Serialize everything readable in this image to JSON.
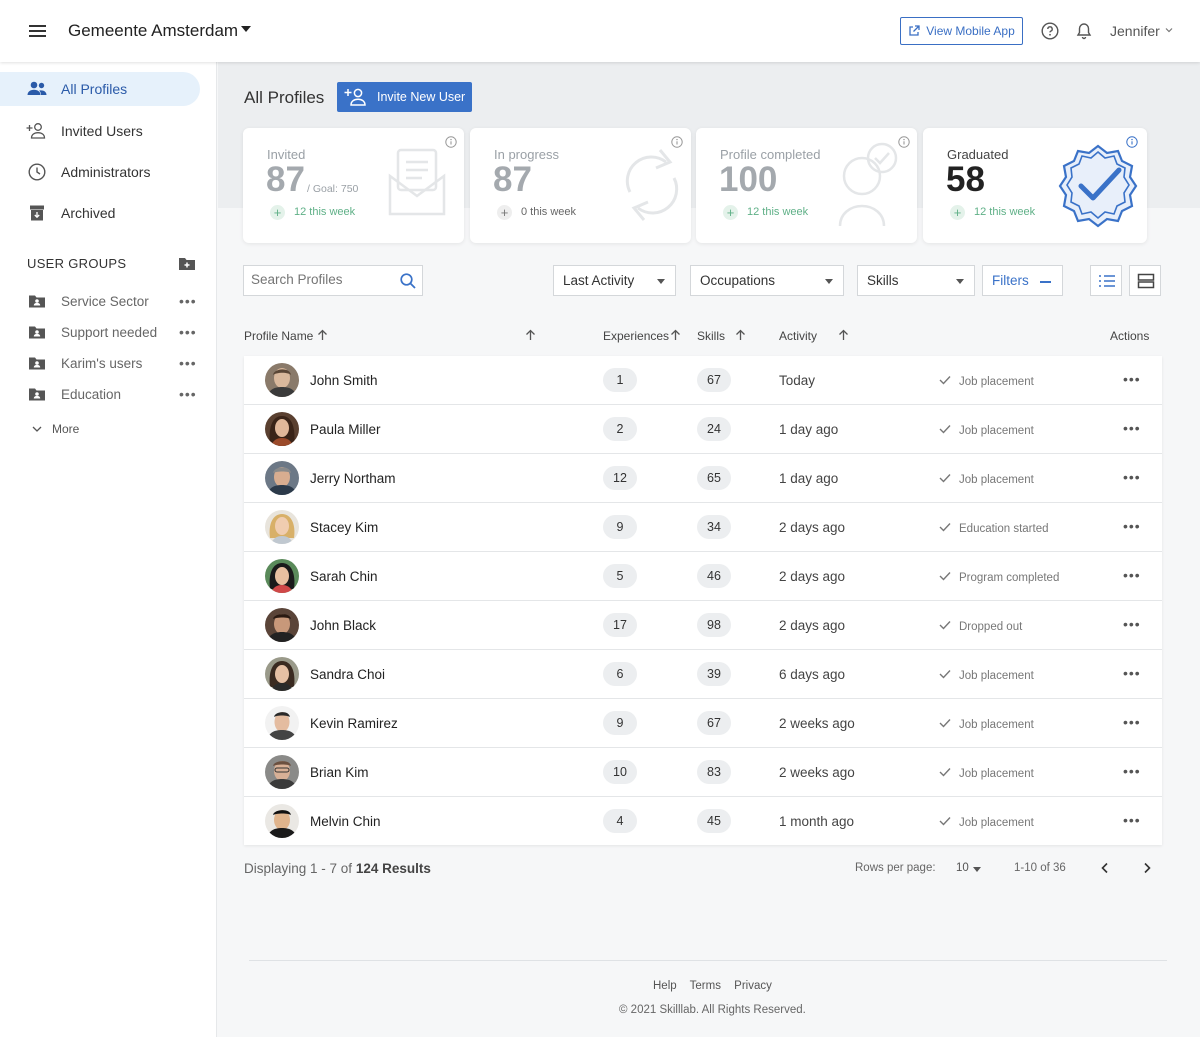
{
  "header": {
    "org_name": "Gemeente Amsterdam",
    "mobile_app_label": "View Mobile App",
    "user_name": "Jennifer"
  },
  "sidebar": {
    "items": [
      {
        "label": "All Profiles",
        "icon": "users-icon",
        "active": true
      },
      {
        "label": "Invited Users",
        "icon": "add-user-icon",
        "active": false
      },
      {
        "label": "Administrators",
        "icon": "clock-icon",
        "active": false
      },
      {
        "label": "Archived",
        "icon": "archive-icon",
        "active": false
      }
    ],
    "groups_title": "USER GROUPS",
    "groups": [
      {
        "label": "Service Sector"
      },
      {
        "label": "Support needed"
      },
      {
        "label": "Karim's users"
      },
      {
        "label": "Education"
      }
    ],
    "more_label": "More"
  },
  "main": {
    "page_title": "All Profiles",
    "invite_label": "Invite New User"
  },
  "stats": [
    {
      "label": "Invited",
      "value": "87",
      "goal": "/ Goal: 750",
      "week": "12 this week"
    },
    {
      "label": "In progress",
      "value": "87",
      "goal": "",
      "week": "0 this week"
    },
    {
      "label": "Profile completed",
      "value": "100",
      "goal": "",
      "week": "12 this week"
    },
    {
      "label": "Graduated",
      "value": "58",
      "goal": "",
      "week": "12 this week"
    }
  ],
  "filters": {
    "search_placeholder": "Search Profiles",
    "last_activity": "Last Activity",
    "occupations": "Occupations",
    "skills": "Skills",
    "filters": "Filters"
  },
  "table": {
    "headers": {
      "name": "Profile Name",
      "experiences": "Experiences",
      "skills": "Skills",
      "activity": "Activity",
      "actions": "Actions"
    },
    "rows": [
      {
        "name": "John Smith",
        "experiences": "1",
        "skills": "67",
        "activity": "Today",
        "status": "Job placement"
      },
      {
        "name": "Paula Miller",
        "experiences": "2",
        "skills": "24",
        "activity": "1 day ago",
        "status": "Job placement"
      },
      {
        "name": "Jerry Northam",
        "experiences": "12",
        "skills": "65",
        "activity": "1 day ago",
        "status": "Job placement"
      },
      {
        "name": "Stacey Kim",
        "experiences": "9",
        "skills": "34",
        "activity": "2 days ago",
        "status": "Education started"
      },
      {
        "name": "Sarah Chin",
        "experiences": "5",
        "skills": "46",
        "activity": "2 days ago",
        "status": "Program completed"
      },
      {
        "name": "John Black",
        "experiences": "17",
        "skills": "98",
        "activity": "2 days ago",
        "status": "Dropped out"
      },
      {
        "name": "Sandra Choi",
        "experiences": "6",
        "skills": "39",
        "activity": "6 days ago",
        "status": "Job placement"
      },
      {
        "name": "Kevin Ramirez",
        "experiences": "9",
        "skills": "67",
        "activity": "2 weeks ago",
        "status": "Job placement"
      },
      {
        "name": "Brian Kim",
        "experiences": "10",
        "skills": "83",
        "activity": "2 weeks ago",
        "status": "Job placement"
      },
      {
        "name": "Melvin Chin",
        "experiences": "4",
        "skills": "45",
        "activity": "1 month ago",
        "status": "Job placement"
      }
    ]
  },
  "pagination": {
    "displaying_prefix": "Displaying 1 - 7 of",
    "displaying_total": "124 Results",
    "rows_per_page_label": "Rows per page:",
    "rows_per_page": "10",
    "range": "1-10 of 36"
  },
  "footer": {
    "links": [
      "Help",
      "Terms",
      "Privacy"
    ],
    "copyright": "© 2021 Skilllab. All Rights Reserved."
  },
  "colors": {
    "accent": "#3a72c8",
    "active_nav_bg": "#e6f1fb",
    "positive": "#5fb087"
  }
}
